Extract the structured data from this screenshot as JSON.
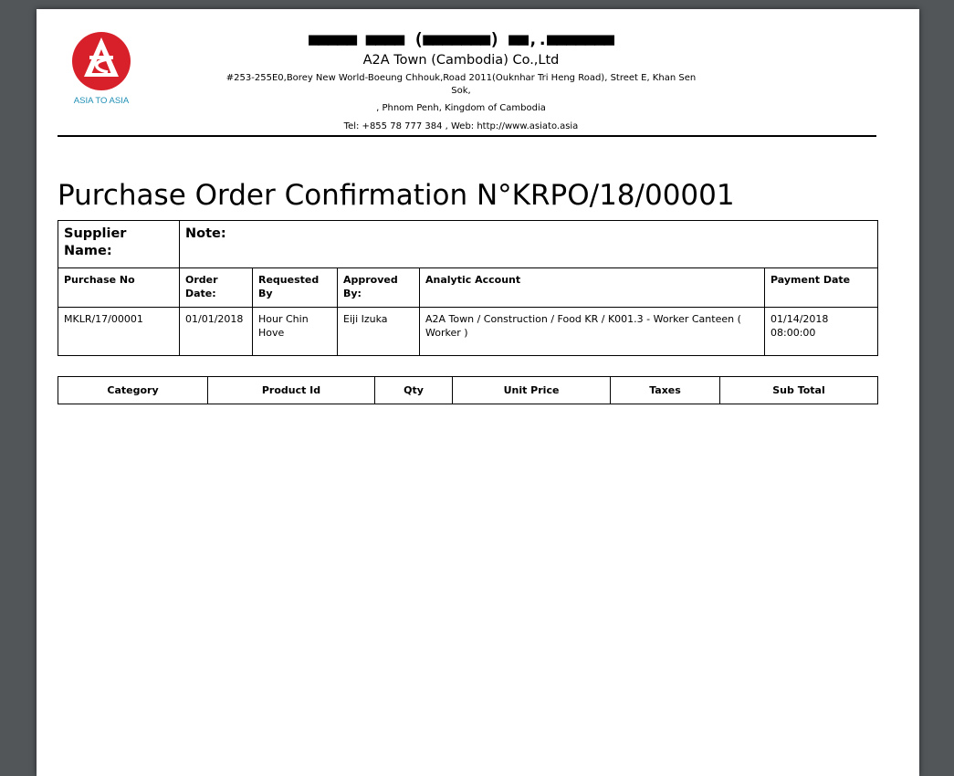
{
  "company": {
    "khmer_name": "■■■■■ ■■■■ (■■■■■■■) ■■,.■■■■■■■",
    "name": "A2A Town (Cambodia) Co.,Ltd",
    "address_line1": "#253-255E0,Borey New World-Boeung Chhouk,Road 2011(Ouknhar Tri Heng Road), Street E, Khan Sen",
    "address_line2": "Sok,",
    "address_line3": ", Phnom Penh, Kingdom of Cambodia",
    "contact": "Tel: +855 78 777 384 , Web: http://www.asiato.asia",
    "logo_text": "ASIA TO ASIA",
    "logo_icon": "asia-to-asia-logo",
    "logo_color": "#d8202a",
    "logo_text_color": "#1f8fb4"
  },
  "document": {
    "title": "Purchase Order Confirmation N°KRPO/18/00001"
  },
  "info": {
    "supplier_label": "Supplier Name:",
    "note_label": "Note:",
    "headers": [
      "Purchase No",
      "Order Date:",
      "Requested By",
      "Approved By:",
      "Analytic Account",
      "Payment Date"
    ],
    "values": [
      "MKLR/17/00001",
      "01/01/2018",
      "Hour Chin Hove",
      "Eiji Izuka",
      "A2A Town / Construction / Food KR / K001.3 - Worker Canteen ( Worker )",
      "01/14/2018 08:00:00"
    ]
  },
  "lines": {
    "headers": [
      "Category",
      "Product Id",
      "Qty",
      "Unit Price",
      "Taxes",
      "Sub Total"
    ]
  },
  "viewer": {
    "background_color": "#525659"
  }
}
